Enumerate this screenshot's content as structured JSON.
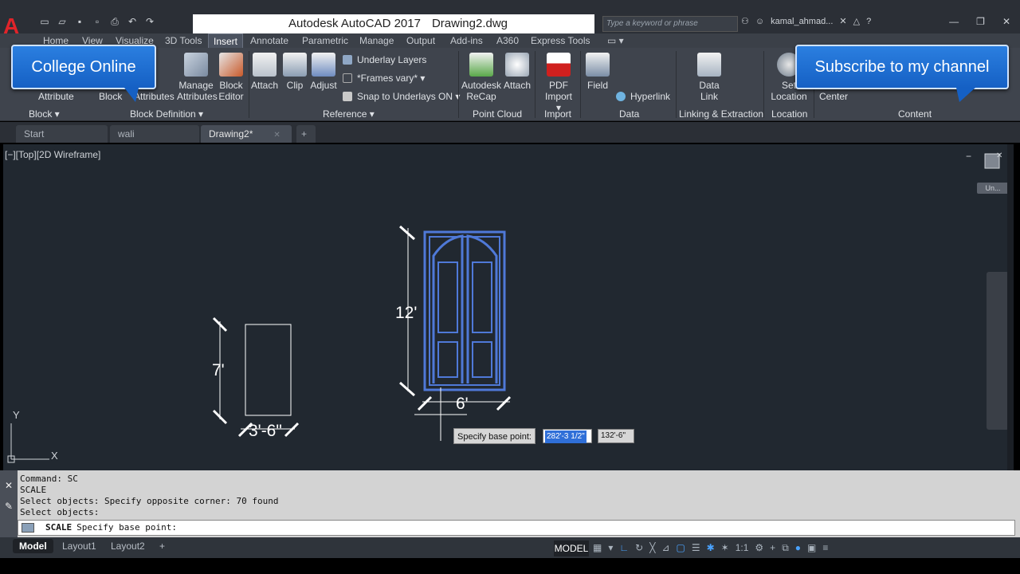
{
  "titlebar": {
    "app_logo": "A",
    "title": "Autodesk AutoCAD 2017",
    "filename": "Drawing2.dwg",
    "search_placeholder": "Type a keyword or phrase",
    "user": "kamal_ahmad...",
    "qat_icons": [
      "new-icon",
      "open-icon",
      "save-icon",
      "saveas-icon",
      "plot-icon",
      "undo-icon",
      "redo-icon"
    ]
  },
  "ribbon_tabs": [
    "Home",
    "View",
    "Visualize",
    "3D Tools",
    "Insert",
    "Annotate",
    "Parametric",
    "Manage",
    "Output",
    "Add-ins",
    "A360",
    "Express Tools"
  ],
  "ribbon_active_tab": "Insert",
  "ribbon": {
    "block_attribute": "Attribute",
    "block_block": "Block",
    "block_attributes": "Attributes",
    "manage_attributes_1": "Manage",
    "manage_attributes_2": "Attributes",
    "block_editor_1": "Block",
    "block_editor_2": "Editor",
    "attach": "Attach",
    "clip": "Clip",
    "adjust": "Adjust",
    "underlay_layers": "Underlay Layers",
    "frames_vary": "*Frames vary*",
    "snap_underlays": "Snap to Underlays ON",
    "recap_1": "Autodesk",
    "recap_2": "ReCap",
    "pc_attach": "Attach",
    "pdf_import_1": "PDF",
    "pdf_import_2": "Import",
    "field": "Field",
    "hyperlink": "Hyperlink",
    "data_link_1": "Data",
    "data_link_2": "Link",
    "set_location_1": "Set",
    "set_location_2": "Location",
    "center": "Center",
    "panels": {
      "block": "Block",
      "block_definition": "Block Definition",
      "reference": "Reference",
      "point_cloud": "Point Cloud",
      "import": "Import",
      "data": "Data",
      "linking": "Linking & Extraction",
      "location": "Location",
      "content": "Content"
    }
  },
  "callouts": {
    "left": "College Online",
    "right": "Subscribe to my channel"
  },
  "file_tabs": [
    "Start",
    "wali library*",
    "Drawing2*"
  ],
  "viewport": {
    "label": "[−][Top][2D Wireframe]",
    "un_button": "Un...",
    "dim_height_door": "12'",
    "dim_width_door": "6'",
    "dim_height_rect": "7'",
    "dim_width_rect": "3'-6\"",
    "axis_y": "Y",
    "axis_x": "X",
    "prompt": "Specify base point:",
    "coord_x": "282'-3 1/2\"",
    "coord_y": "132'-6\""
  },
  "command": {
    "history": [
      "Command: SC",
      "SCALE",
      "Select objects: Specify opposite corner: 70 found",
      "Select objects:"
    ],
    "current_cmd": "SCALE",
    "current_prompt": "Specify base point:"
  },
  "statusbar": {
    "layouts": [
      "Model",
      "Layout1",
      "Layout2"
    ],
    "model_button": "MODEL",
    "scale": "1:1"
  },
  "colors": {
    "viewport_bg": "#212830",
    "door_stroke": "#4f79d8",
    "dim_white": "#ffffff",
    "callout_blue": "#1f6fd6"
  }
}
